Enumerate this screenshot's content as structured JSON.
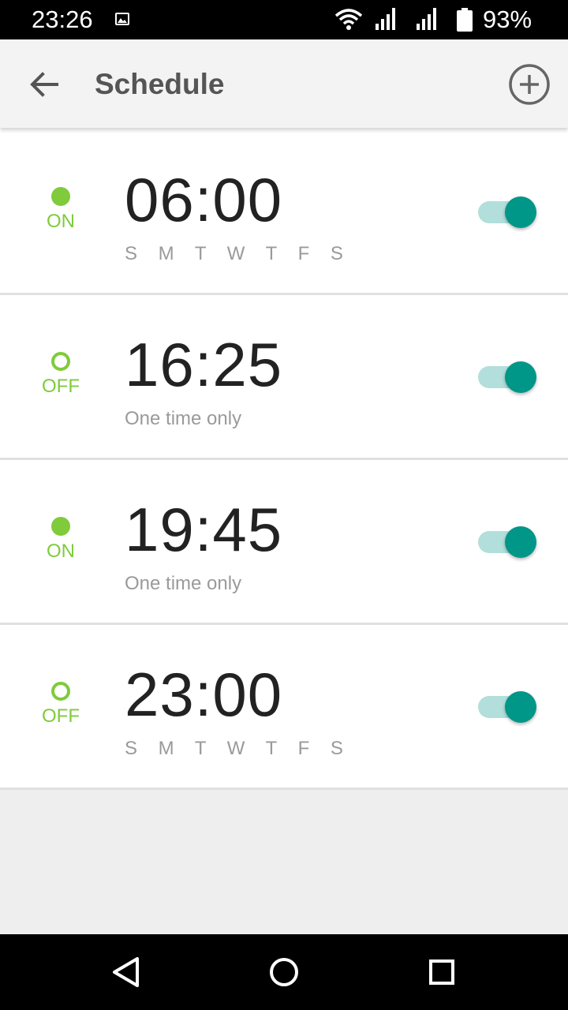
{
  "status_bar": {
    "time": "23:26",
    "battery_percent": "93%",
    "icons": [
      "image-notification-icon",
      "wifi-icon",
      "signal-icon",
      "signal-icon",
      "battery-icon"
    ]
  },
  "app_bar": {
    "title": "Schedule",
    "back_icon": "arrow-back-icon",
    "add_icon": "add-circle-icon"
  },
  "schedules": [
    {
      "state": "ON",
      "active": true,
      "time": "06:00",
      "subtitle": "S M T W T F S",
      "toggle_on": true
    },
    {
      "state": "OFF",
      "active": false,
      "time": "16:25",
      "subtitle": "One time only",
      "toggle_on": true
    },
    {
      "state": "ON",
      "active": true,
      "time": "19:45",
      "subtitle": "One time only",
      "toggle_on": true
    },
    {
      "state": "OFF",
      "active": false,
      "time": "23:00",
      "subtitle": "S M T W T F S",
      "toggle_on": true
    }
  ],
  "colors": {
    "accent_green": "#7fcb3b",
    "toggle_thumb": "#009688",
    "toggle_track": "#b2dfdb"
  },
  "nav_bar": {
    "icons": [
      "back-triangle-icon",
      "home-circle-icon",
      "recents-square-icon"
    ]
  }
}
